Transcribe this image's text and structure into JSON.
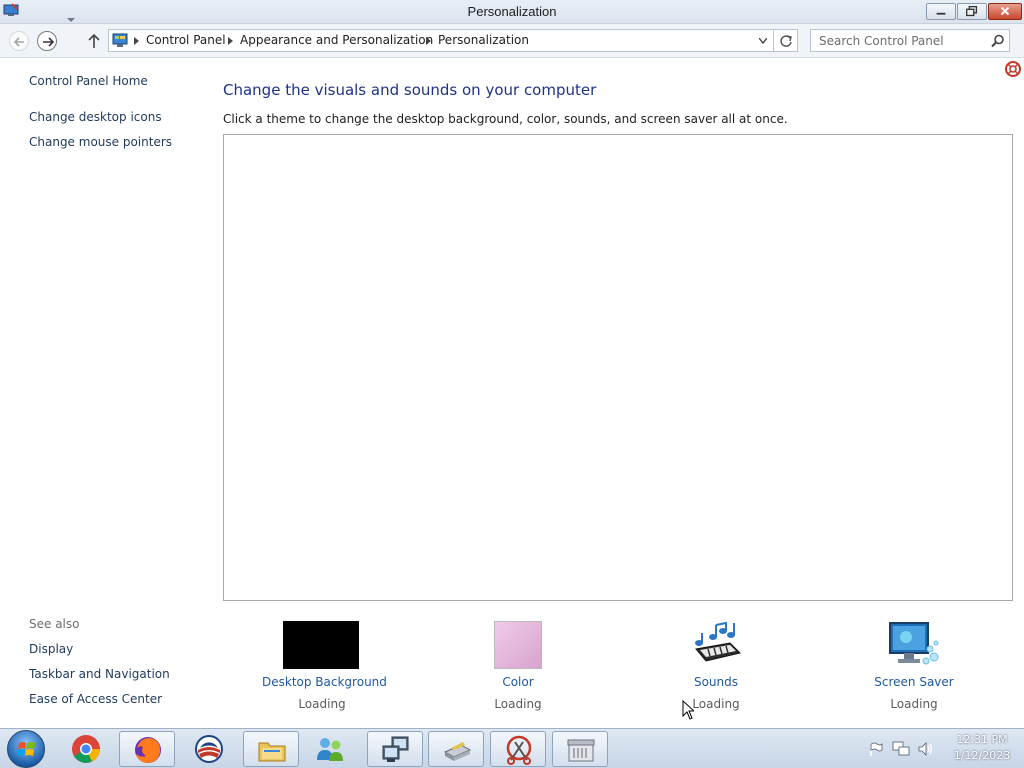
{
  "window": {
    "title": "Personalization"
  },
  "address": {
    "breadcrumbs": [
      "Control Panel",
      "Appearance and Personalization",
      "Personalization"
    ],
    "search_placeholder": "Search Control Panel"
  },
  "left_pane": {
    "links": [
      "Control Panel Home",
      "Change desktop icons",
      "Change mouse pointers"
    ],
    "see_also_label": "See also",
    "see_also": [
      "Display",
      "Taskbar and Navigation",
      "Ease of Access Center"
    ]
  },
  "main": {
    "heading": "Change the visuals and sounds on your computer",
    "subtitle": "Click a theme to change the desktop background, color, sounds, and screen saver all at once.",
    "tiles": [
      {
        "label": "Desktop Background",
        "status": "Loading",
        "icon": "desktop-background-icon"
      },
      {
        "label": "Color",
        "status": "Loading",
        "icon": "color-swatch-icon"
      },
      {
        "label": "Sounds",
        "status": "Loading",
        "icon": "sounds-icon"
      },
      {
        "label": "Screen Saver",
        "status": "Loading",
        "icon": "screen-saver-icon"
      }
    ]
  },
  "taskbar": {
    "apps": [
      "chrome-icon",
      "firefox-icon",
      "obama-logo-icon",
      "file-explorer-icon",
      "users-icon",
      "remote-desktop-icon",
      "printer-icon",
      "snipping-tool-icon",
      "archive-icon"
    ],
    "clock_time": "12:31 PM",
    "clock_date": "1/12/2023"
  },
  "colors": {
    "heading": "#1e3287",
    "link": "#1e5aa0",
    "color_swatch": "#e6b6dc",
    "desktop_background_swatch": "#000000"
  }
}
